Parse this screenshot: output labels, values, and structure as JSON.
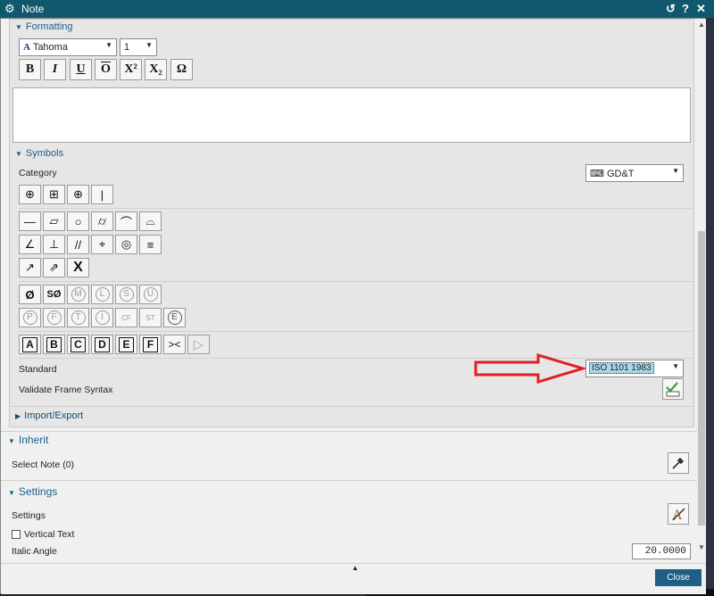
{
  "window": {
    "title": "Note",
    "reset": "↺",
    "help": "?",
    "close": "✕"
  },
  "formatting": {
    "header": "Formatting",
    "font": "Tahoma",
    "size": "1",
    "buttons": [
      "B",
      "I",
      "U",
      "O",
      "X²",
      "X₂",
      "Ω"
    ]
  },
  "symbols": {
    "header": "Symbols",
    "category_label": "Category",
    "category_value": "GD&T",
    "row1": [
      "⊕",
      "⊞",
      "⊕",
      "|"
    ],
    "row2": [
      "—",
      "▱",
      "○",
      "⌭",
      "⌒",
      "⌓"
    ],
    "row3": [
      "∠",
      "⊥",
      "//",
      "⌖",
      "◎",
      "≡"
    ],
    "row4": [
      "↗",
      "⇗",
      "X"
    ],
    "row5": [
      "Ø",
      "SØ",
      "M",
      "L",
      "S",
      "U"
    ],
    "row6": [
      "P",
      "F",
      "T",
      "I",
      "CF",
      "ST",
      "E"
    ],
    "row7": [
      "A",
      "B",
      "C",
      "D",
      "E",
      "F",
      "><",
      "▷"
    ]
  },
  "standard": {
    "label": "Standard",
    "value": "ISO 1101 1983"
  },
  "validate": {
    "label": "Validate Frame Syntax"
  },
  "import_export": {
    "header": "Import/Export"
  },
  "inherit": {
    "header": "Inherit",
    "select_label": "Select Note (0)"
  },
  "settings": {
    "header": "Settings",
    "label": "Settings",
    "vertical_text": "Vertical Text",
    "italic_angle": "Italic Angle",
    "italic_value": "20.0000"
  },
  "footer": {
    "close": "Close"
  }
}
